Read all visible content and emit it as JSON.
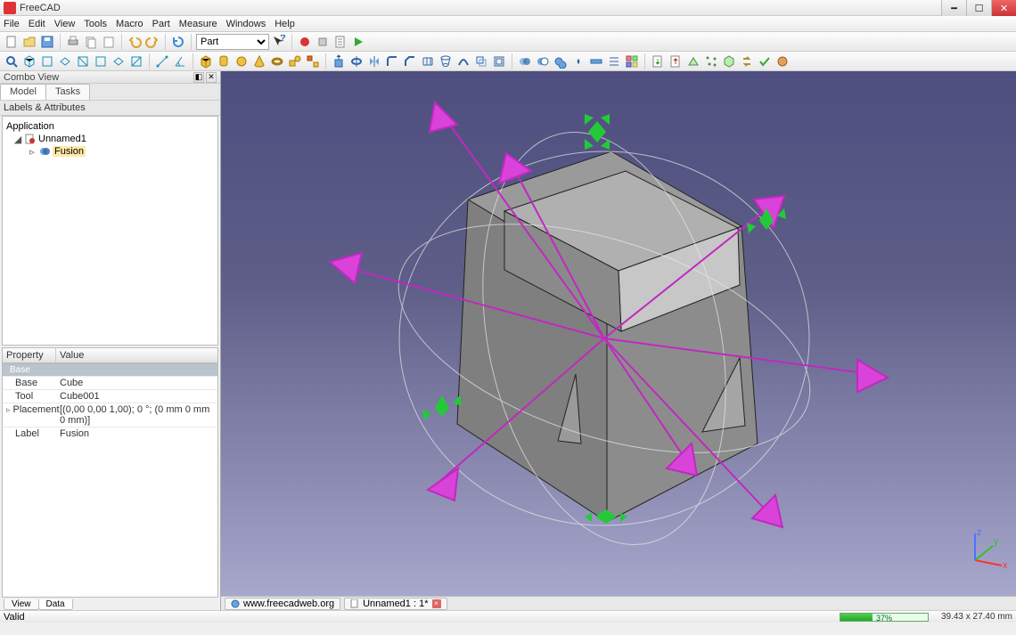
{
  "window": {
    "title": "FreeCAD"
  },
  "menu": [
    "File",
    "Edit",
    "View",
    "Tools",
    "Macro",
    "Part",
    "Measure",
    "Windows",
    "Help"
  ],
  "workbench": {
    "selected": "Part"
  },
  "combo": {
    "title": "Combo View",
    "tabs": [
      {
        "label": "Model",
        "active": true
      },
      {
        "label": "Tasks",
        "active": false
      }
    ],
    "tree_header": "Labels & Attributes",
    "tree": {
      "root": "Application",
      "doc": "Unnamed1",
      "item": "Fusion"
    },
    "prop_headers": {
      "c1": "Property",
      "c2": "Value"
    },
    "prop_group": "Base",
    "props": [
      {
        "name": "Base",
        "value": "Cube"
      },
      {
        "name": "Tool",
        "value": "Cube001"
      },
      {
        "name": "Placement",
        "value": "[(0,00 0,00 1,00); 0 °; (0 mm  0 mm  0 mm)]",
        "exp": true
      },
      {
        "name": "Label",
        "value": "Fusion"
      }
    ],
    "bottom_tabs": [
      {
        "label": "View",
        "active": false
      },
      {
        "label": "Data",
        "active": true
      }
    ]
  },
  "doc_tabs": [
    {
      "label": "www.freecadweb.org",
      "closable": false
    },
    {
      "label": "Unnamed1 : 1*",
      "closable": true
    }
  ],
  "status": {
    "left": "Valid",
    "progress_pct": 37,
    "progress_label": "37%",
    "dims": "39.43 x 27.40 mm"
  },
  "axis": {
    "x": "x",
    "y": "y",
    "z": "z"
  }
}
